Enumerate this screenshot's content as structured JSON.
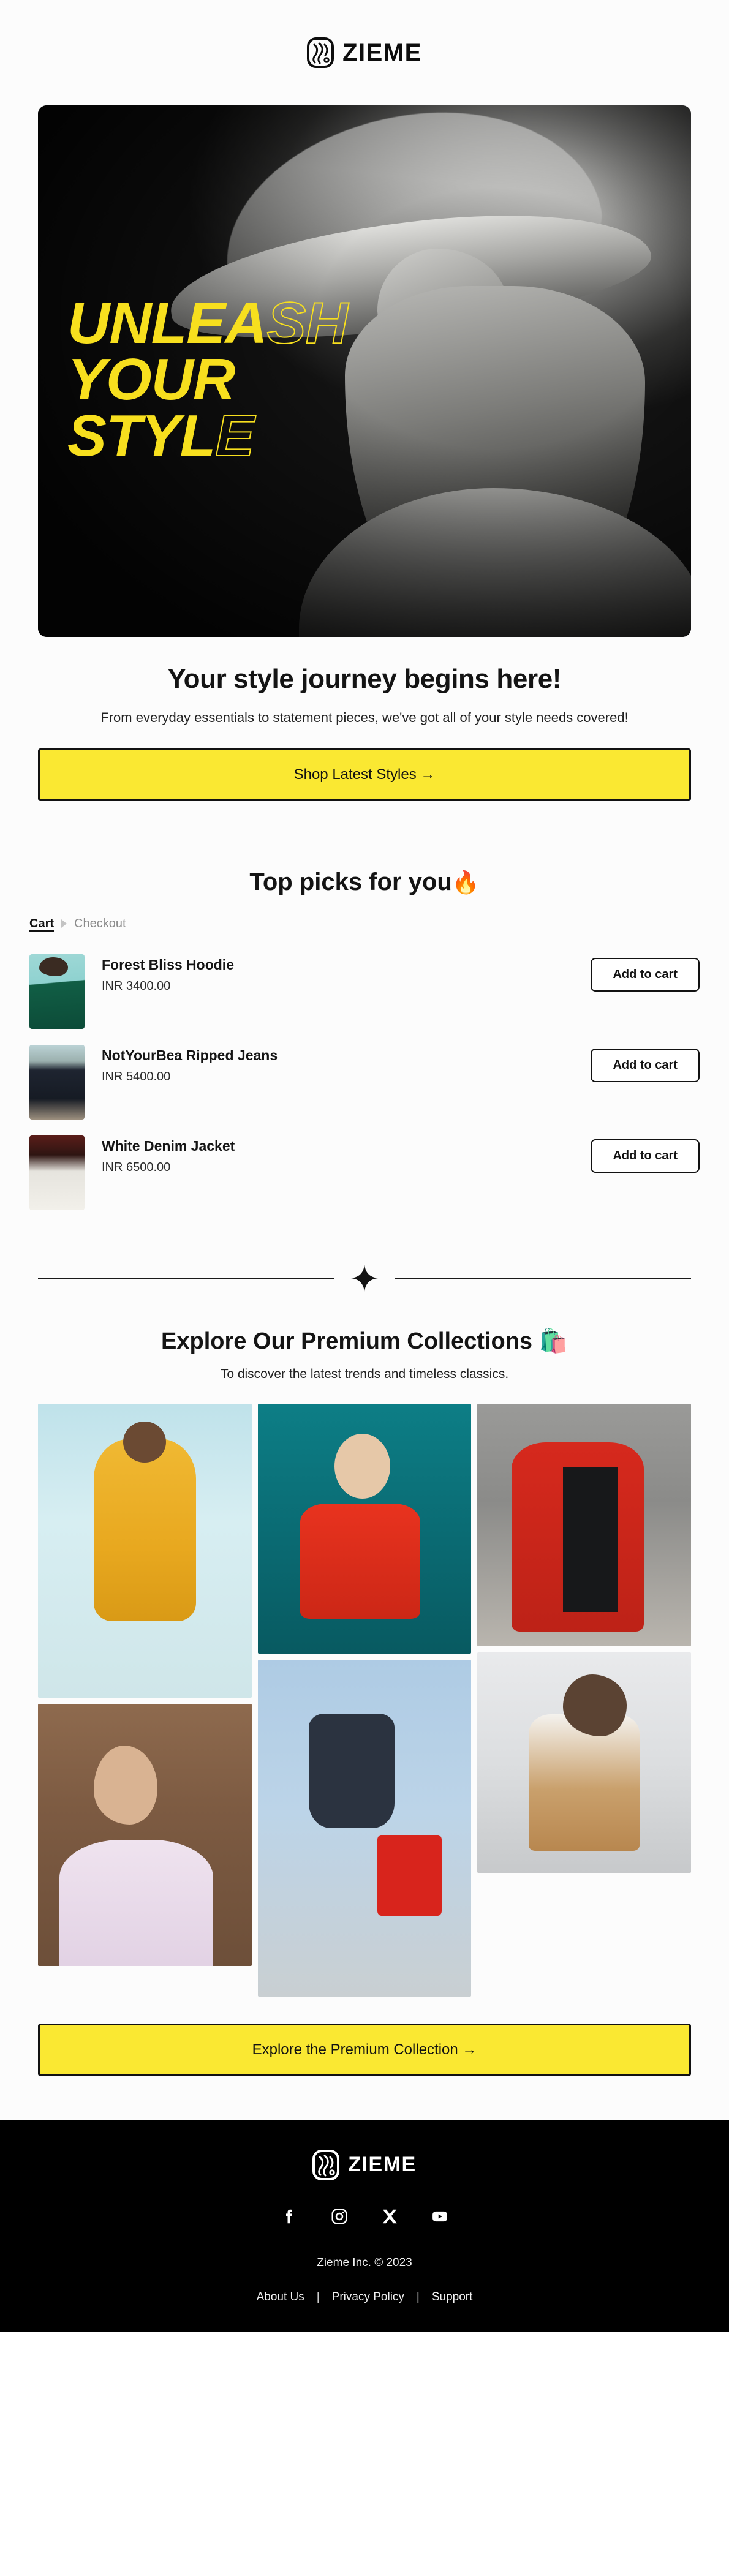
{
  "brand": {
    "name": "ZIEME",
    "logo_icon": "zieme-swirl-logo-icon"
  },
  "hero": {
    "line1": "UNLEA",
    "line1_outline": "SH",
    "line2": "YOUR",
    "line3": "STYL",
    "line3_outline": "E",
    "alt": "monochrome-model-wide-brim-hat"
  },
  "intro": {
    "heading": "Your style journey begins here!",
    "subtext": "From everyday essentials to statement pieces, we've got all of your style needs covered!",
    "cta_label": "Shop Latest Styles  →"
  },
  "picks": {
    "title": "Top picks for you",
    "title_emoji": "🔥",
    "breadcrumb": {
      "current": "Cart",
      "next": "Checkout",
      "separator_icon": "triangle-right-icon"
    },
    "add_to_cart_label": "Add to cart",
    "items": [
      {
        "name": "Forest Bliss Hoodie",
        "price": "INR 3400.00",
        "thumb": "forest-bliss-hoodie-thumb"
      },
      {
        "name": "NotYourBea Ripped Jeans",
        "price": "INR 5400.00",
        "thumb": "notyourbea-ripped-jeans-thumb"
      },
      {
        "name": "White Denim Jacket",
        "price": "INR 6500.00",
        "thumb": "white-denim-jacket-thumb"
      }
    ]
  },
  "divider": {
    "icon": "four-point-sparkle-icon"
  },
  "collections": {
    "heading": "Explore Our Premium Collections",
    "heading_emoji": "🛍️",
    "subtext": "To discover the latest trends and timeless classics.",
    "cta_label": "Explore the Premium Collection  →",
    "gallery": [
      {
        "alt": "yellow-tracksuit-look",
        "class": "g-a"
      },
      {
        "alt": "lilac-ruffle-top-look",
        "class": "g-b"
      },
      {
        "alt": "red-graphic-tee-look",
        "class": "g-c"
      },
      {
        "alt": "streetwear-sneakers-look",
        "class": "g-d"
      },
      {
        "alt": "red-trench-coat-look",
        "class": "g-e"
      },
      {
        "alt": "tan-wrap-coat-look",
        "class": "g-f"
      }
    ]
  },
  "footer": {
    "brand_name": "ZIEME",
    "socials": [
      {
        "name": "facebook-icon",
        "label": "Facebook"
      },
      {
        "name": "instagram-icon",
        "label": "Instagram"
      },
      {
        "name": "x-twitter-icon",
        "label": "X"
      },
      {
        "name": "youtube-icon",
        "label": "YouTube"
      }
    ],
    "copyright": "Zieme Inc. © 2023",
    "links": [
      "About Us",
      "Privacy Policy",
      "Support"
    ],
    "link_separator": "|"
  },
  "colors": {
    "accent_yellow": "#FAE832",
    "hero_yellow": "#F7DF1E",
    "ink": "#121212",
    "footer_bg": "#000000",
    "muted": "#8b8b8b"
  }
}
